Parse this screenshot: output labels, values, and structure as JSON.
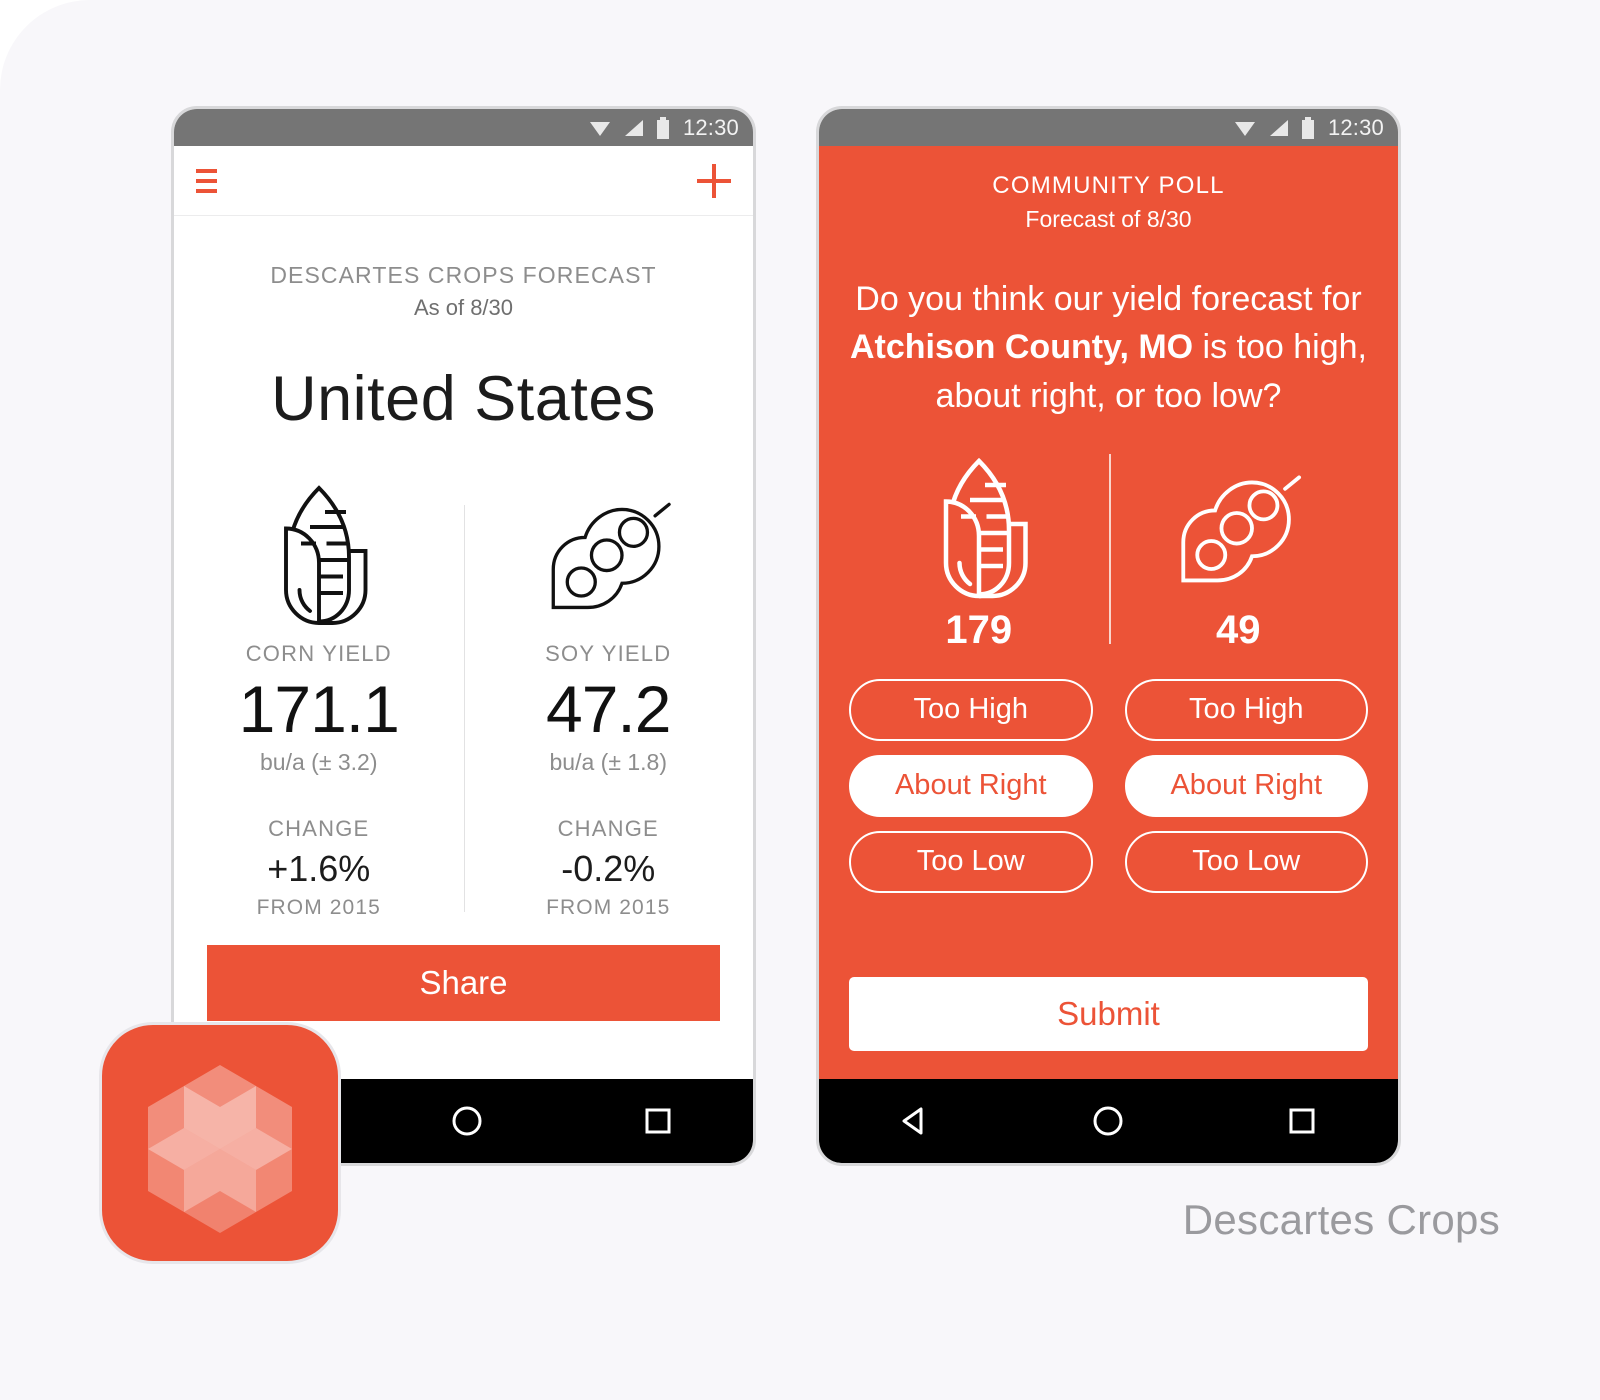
{
  "brand": {
    "name": "Descartes Crops"
  },
  "colors": {
    "accent": "#ec5337",
    "background": "#f8f7fa",
    "statusbar": "#757575",
    "navbar": "#000000",
    "muted_text": "#8d8d8d",
    "brand_text": "#9a9a9e"
  },
  "left_phone": {
    "statusbar": {
      "time": "12:30",
      "icons": [
        "wifi-icon",
        "signal-icon",
        "battery-icon"
      ]
    },
    "appbar": {
      "menu_icon": "hamburger-icon",
      "add_icon": "plus-icon"
    },
    "forecast": {
      "eyebrow": "DESCARTES CROPS FORECAST",
      "as_of": "As of 8/30",
      "region": "United States",
      "crops": [
        {
          "icon": "corn-icon",
          "label": "CORN YIELD",
          "value": "171.1",
          "unit": "bu/a (± 3.2)",
          "change_label": "CHANGE",
          "change_value": "+1.6%",
          "change_from": "FROM 2015"
        },
        {
          "icon": "soy-icon",
          "label": "SOY YIELD",
          "value": "47.2",
          "unit": "bu/a (± 1.8)",
          "change_label": "CHANGE",
          "change_value": "-0.2%",
          "change_from": "FROM 2015"
        }
      ],
      "share_label": "Share"
    },
    "navbar": {
      "buttons": [
        "home-circle-icon",
        "recents-square-icon"
      ]
    }
  },
  "right_phone": {
    "statusbar": {
      "time": "12:30",
      "icons": [
        "wifi-icon",
        "signal-icon",
        "battery-icon"
      ]
    },
    "poll": {
      "eyebrow": "COMMUNITY POLL",
      "as_of": "Forecast of 8/30",
      "question_part1": "Do you think our yield forecast for ",
      "question_location": "Atchison County, MO",
      "question_part2": " is too high, about right, or too low?",
      "crops": [
        {
          "icon": "corn-icon",
          "count": "179",
          "options": [
            {
              "label": "Too High",
              "selected": false
            },
            {
              "label": "About Right",
              "selected": true
            },
            {
              "label": "Too Low",
              "selected": false
            }
          ]
        },
        {
          "icon": "soy-icon",
          "count": "49",
          "options": [
            {
              "label": "Too High",
              "selected": false
            },
            {
              "label": "About Right",
              "selected": true
            },
            {
              "label": "Too Low",
              "selected": false
            }
          ]
        }
      ],
      "submit_label": "Submit"
    },
    "navbar": {
      "buttons": [
        "back-triangle-icon",
        "home-circle-icon",
        "recents-square-icon"
      ]
    }
  }
}
